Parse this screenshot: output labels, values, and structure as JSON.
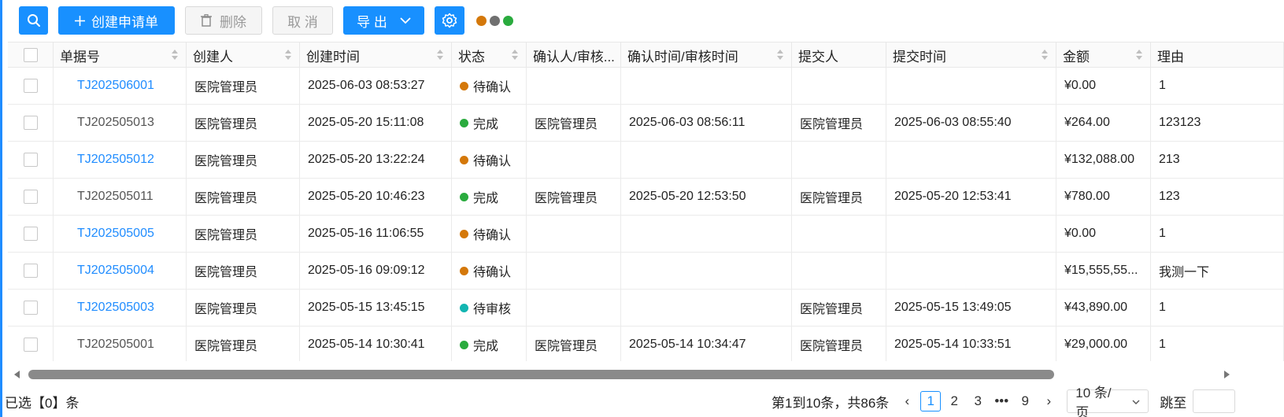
{
  "toolbar": {
    "create_label": "创建申请单",
    "delete_label": "删除",
    "cancel_label": "取 消",
    "export_label": "导 出",
    "brand_colors": {
      "primary": "#1890ff",
      "dot_orange": "#d4780a",
      "dot_gray": "#707070",
      "dot_green": "#2aab3e"
    }
  },
  "columns": [
    "单据号",
    "创建人",
    "创建时间",
    "状态",
    "确认人/审核...",
    "确认时间/审核时间",
    "提交人",
    "提交时间",
    "金额",
    "理由"
  ],
  "rows": [
    {
      "id": "TJ202506001",
      "creator": "医院管理员",
      "created": "2025-06-03 08:53:27",
      "status": "待确认",
      "confirmer": "",
      "confirm_time": "",
      "submitter": "",
      "submit_time": "",
      "amount": "¥0.00",
      "reason": "1"
    },
    {
      "id": "TJ202505013",
      "creator": "医院管理员",
      "created": "2025-05-20 15:11:08",
      "status": "完成",
      "confirmer": "医院管理员",
      "confirm_time": "2025-06-03 08:56:11",
      "submitter": "医院管理员",
      "submit_time": "2025-06-03 08:55:40",
      "amount": "¥264.00",
      "reason": "123123"
    },
    {
      "id": "TJ202505012",
      "creator": "医院管理员",
      "created": "2025-05-20 13:22:24",
      "status": "待确认",
      "confirmer": "",
      "confirm_time": "",
      "submitter": "",
      "submit_time": "",
      "amount": "¥132,088.00",
      "reason": "213"
    },
    {
      "id": "TJ202505011",
      "creator": "医院管理员",
      "created": "2025-05-20 10:46:23",
      "status": "完成",
      "confirmer": "医院管理员",
      "confirm_time": "2025-05-20 12:53:50",
      "submitter": "医院管理员",
      "submit_time": "2025-05-20 12:53:41",
      "amount": "¥780.00",
      "reason": "123"
    },
    {
      "id": "TJ202505005",
      "creator": "医院管理员",
      "created": "2025-05-16 11:06:55",
      "status": "待确认",
      "confirmer": "",
      "confirm_time": "",
      "submitter": "",
      "submit_time": "",
      "amount": "¥0.00",
      "reason": "1"
    },
    {
      "id": "TJ202505004",
      "creator": "医院管理员",
      "created": "2025-05-16 09:09:12",
      "status": "待确认",
      "confirmer": "",
      "confirm_time": "",
      "submitter": "",
      "submit_time": "",
      "amount": "¥15,555,55...",
      "reason": "我测一下"
    },
    {
      "id": "TJ202505003",
      "creator": "医院管理员",
      "created": "2025-05-15 13:45:15",
      "status": "待审核",
      "confirmer": "",
      "confirm_time": "",
      "submitter": "医院管理员",
      "submit_time": "2025-05-15 13:49:05",
      "amount": "¥43,890.00",
      "reason": "1"
    },
    {
      "id": "TJ202505001",
      "creator": "医院管理员",
      "created": "2025-05-14 10:30:41",
      "status": "完成",
      "confirmer": "医院管理员",
      "confirm_time": "2025-05-14 10:34:47",
      "submitter": "医院管理员",
      "submit_time": "2025-05-14 10:33:51",
      "amount": "¥29,000.00",
      "reason": "1"
    }
  ],
  "status_colors": {
    "待确认": "#d4780a",
    "完成": "#2aab3e",
    "待审核": "#13b5b1"
  },
  "footer": {
    "selected_text": "已选【0】条",
    "range_text": "第1到10条，共86条",
    "pages": [
      "1",
      "2",
      "3",
      "•••",
      "9"
    ],
    "page_size": "10 条/页",
    "jump_label": "跳至"
  }
}
